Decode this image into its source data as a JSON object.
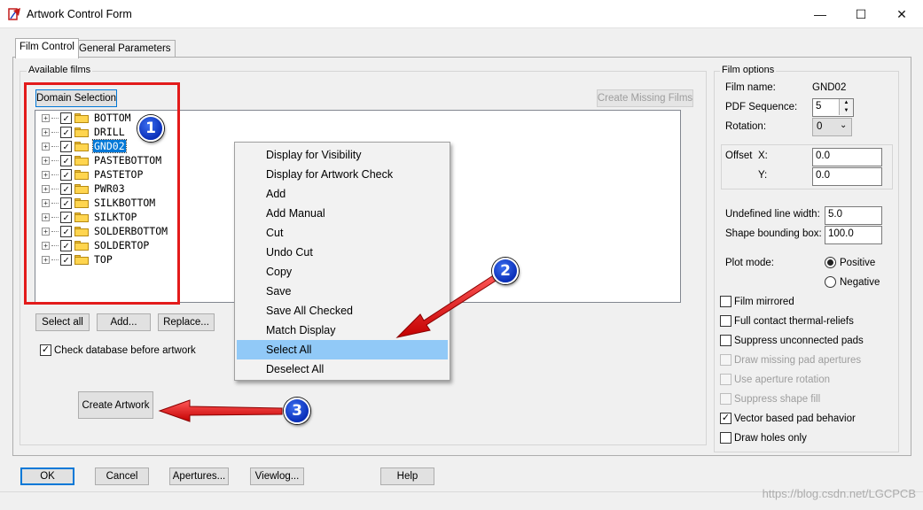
{
  "window": {
    "title": "Artwork Control Form",
    "minimize": "—",
    "maximize": "☐",
    "close": "✕"
  },
  "tabs": [
    {
      "label": "Film Control",
      "active": true
    },
    {
      "label": "General Parameters",
      "active": false
    }
  ],
  "available_films": {
    "group_label": "Available films",
    "domain_selection_label": "Domain Selection",
    "create_missing_label": "Create Missing Films",
    "films": [
      {
        "name": "BOTTOM",
        "checked": true
      },
      {
        "name": "DRILL",
        "checked": true
      },
      {
        "name": "GND02",
        "checked": true,
        "selected": true
      },
      {
        "name": "PASTEBOTTOM",
        "checked": true
      },
      {
        "name": "PASTETOP",
        "checked": true
      },
      {
        "name": "PWR03",
        "checked": true
      },
      {
        "name": "SILKBOTTOM",
        "checked": true
      },
      {
        "name": "SILKTOP",
        "checked": true
      },
      {
        "name": "SOLDERBOTTOM",
        "checked": true
      },
      {
        "name": "SOLDERTOP",
        "checked": true
      },
      {
        "name": "TOP",
        "checked": true
      }
    ],
    "select_all_label": "Select all",
    "add_label": "Add...",
    "replace_label": "Replace...",
    "check_database_label": "Check database before artwork",
    "check_database_checked": true,
    "create_artwork_label": "Create Artwork"
  },
  "context_menu": {
    "items": [
      "Display for Visibility",
      "Display for Artwork Check",
      "Add",
      "Add Manual",
      "Cut",
      "Undo Cut",
      "Copy",
      "Save",
      "Save All Checked",
      "Match Display",
      "Select All",
      "Deselect All"
    ],
    "highlighted": "Select All"
  },
  "annotations": {
    "badge_1": "1",
    "badge_2": "2",
    "badge_3": "3",
    "color": "#e31b1b"
  },
  "film_options": {
    "group_label": "Film options",
    "film_name_label": "Film name:",
    "film_name_value": "GND02",
    "pdf_sequence_label": "PDF Sequence:",
    "pdf_sequence_value": "5",
    "rotation_label": "Rotation:",
    "rotation_value": "0",
    "offset_label": "Offset",
    "x_label": "X:",
    "x_value": "0.0",
    "y_label": "Y:",
    "y_value": "0.0",
    "undefined_line_width_label": "Undefined line width:",
    "undefined_line_width_value": "5.0",
    "shape_bounding_box_label": "Shape bounding box:",
    "shape_bounding_box_value": "100.0",
    "plot_mode_label": "Plot mode:",
    "positive_label": "Positive",
    "negative_label": "Negative",
    "plot_mode_value": "Positive",
    "checkboxes": [
      {
        "label": "Film mirrored",
        "checked": false,
        "enabled": true
      },
      {
        "label": "Full contact thermal-reliefs",
        "checked": false,
        "enabled": true
      },
      {
        "label": "Suppress unconnected pads",
        "checked": false,
        "enabled": true
      },
      {
        "label": "Draw missing pad apertures",
        "checked": false,
        "enabled": false
      },
      {
        "label": "Use aperture rotation",
        "checked": false,
        "enabled": false
      },
      {
        "label": "Suppress shape fill",
        "checked": false,
        "enabled": false
      },
      {
        "label": "Vector based pad behavior",
        "checked": true,
        "enabled": true
      },
      {
        "label": "Draw holes only",
        "checked": false,
        "enabled": true
      }
    ]
  },
  "footer": {
    "ok_label": "OK",
    "cancel_label": "Cancel",
    "apertures_label": "Apertures...",
    "viewlog_label": "Viewlog...",
    "help_label": "Help"
  },
  "watermark": "https://blog.csdn.net/LGCPCB"
}
